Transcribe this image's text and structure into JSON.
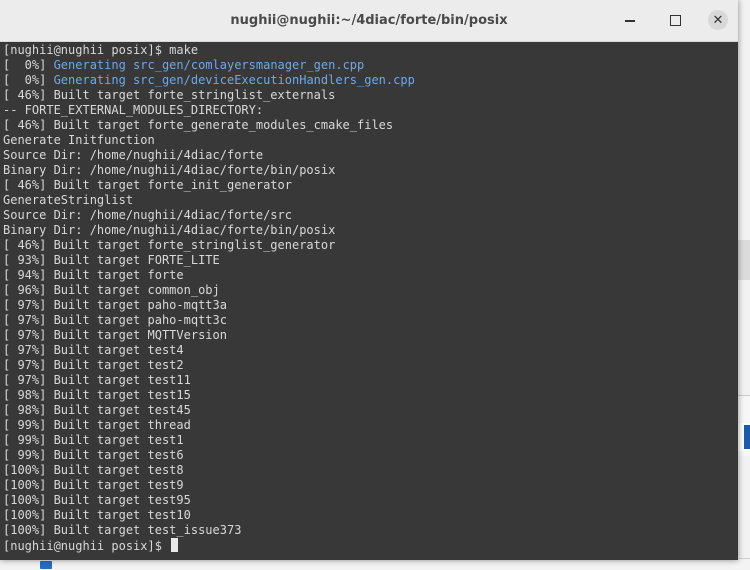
{
  "window": {
    "title": "nughii@nughii:~/4diac/forte/bin/posix"
  },
  "controls": {
    "minimize_icon": "minimize-icon",
    "maximize_icon": "maximize-icon",
    "close_glyph": "✕"
  },
  "terminal": {
    "lines": [
      {
        "text": "[nughii@nughii posix]$ make",
        "style": "normal"
      },
      {
        "prefix": "[  0%] ",
        "text": "Generating src_gen/comlayersmanager_gen.cpp",
        "style": "blue"
      },
      {
        "prefix": "[  0%] ",
        "text": "Generating src_gen/deviceExecutionHandlers_gen.cpp",
        "style": "blue"
      },
      {
        "text": "[ 46%] Built target forte_stringlist_externals",
        "style": "normal"
      },
      {
        "text": "-- FORTE_EXTERNAL_MODULES_DIRECTORY:",
        "style": "normal"
      },
      {
        "text": "[ 46%] Built target forte_generate_modules_cmake_files",
        "style": "normal"
      },
      {
        "text": "Generate Initfunction",
        "style": "normal"
      },
      {
        "text": "Source Dir: /home/nughii/4diac/forte",
        "style": "normal"
      },
      {
        "text": "Binary Dir: /home/nughii/4diac/forte/bin/posix",
        "style": "normal"
      },
      {
        "text": "[ 46%] Built target forte_init_generator",
        "style": "normal"
      },
      {
        "text": "GenerateStringlist",
        "style": "normal"
      },
      {
        "text": "Source Dir: /home/nughii/4diac/forte/src",
        "style": "normal"
      },
      {
        "text": "Binary Dir: /home/nughii/4diac/forte/bin/posix",
        "style": "normal"
      },
      {
        "text": "[ 46%] Built target forte_stringlist_generator",
        "style": "normal"
      },
      {
        "text": "[ 93%] Built target FORTE_LITE",
        "style": "normal"
      },
      {
        "text": "[ 94%] Built target forte",
        "style": "normal"
      },
      {
        "text": "[ 96%] Built target common_obj",
        "style": "normal"
      },
      {
        "text": "[ 97%] Built target paho-mqtt3a",
        "style": "normal"
      },
      {
        "text": "[ 97%] Built target paho-mqtt3c",
        "style": "normal"
      },
      {
        "text": "[ 97%] Built target MQTTVersion",
        "style": "normal"
      },
      {
        "text": "[ 97%] Built target test4",
        "style": "normal"
      },
      {
        "text": "[ 97%] Built target test2",
        "style": "normal"
      },
      {
        "text": "[ 97%] Built target test11",
        "style": "normal"
      },
      {
        "text": "[ 98%] Built target test15",
        "style": "normal"
      },
      {
        "text": "[ 98%] Built target test45",
        "style": "normal"
      },
      {
        "text": "[ 99%] Built target thread",
        "style": "normal"
      },
      {
        "text": "[ 99%] Built target test1",
        "style": "normal"
      },
      {
        "text": "[ 99%] Built target test6",
        "style": "normal"
      },
      {
        "text": "[100%] Built target test8",
        "style": "normal"
      },
      {
        "text": "[100%] Built target test9",
        "style": "normal"
      },
      {
        "text": "[100%] Built target test95",
        "style": "normal"
      },
      {
        "text": "[100%] Built target test10",
        "style": "normal"
      },
      {
        "text": "[100%] Built target test_issue373",
        "style": "normal"
      }
    ],
    "prompt": "[nughii@nughii posix]$ "
  },
  "colors": {
    "terminal_bg": "#383838",
    "text": "#d8d8d8",
    "generating": "#6ea8e8",
    "titlebar_bg": "#ececec"
  }
}
